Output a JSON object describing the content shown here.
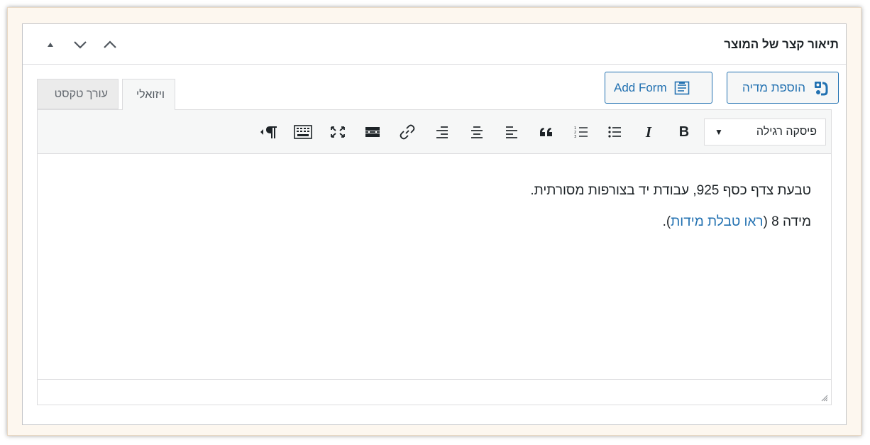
{
  "metabox": {
    "title": "תיאור קצר של המוצר"
  },
  "media_buttons": {
    "add_media_label": "הוספת מדיה",
    "add_form_label": "Add Form"
  },
  "tabs": {
    "visual": "ויזואלי",
    "text": "עורך טקסט"
  },
  "toolbar": {
    "format_value": "פיסקה רגילה",
    "bold": "B",
    "italic": "I"
  },
  "content": {
    "line1": "טבעת צדף כסף 925, עבודת יד בצורפות מסורתית.",
    "line2_prefix": "מידה 8 (",
    "line2_link": "ראו טבלת מידות",
    "line2_suffix": ")."
  },
  "colors": {
    "accent": "#2271b1",
    "text": "#1d2327",
    "border": "#dcdcde"
  }
}
